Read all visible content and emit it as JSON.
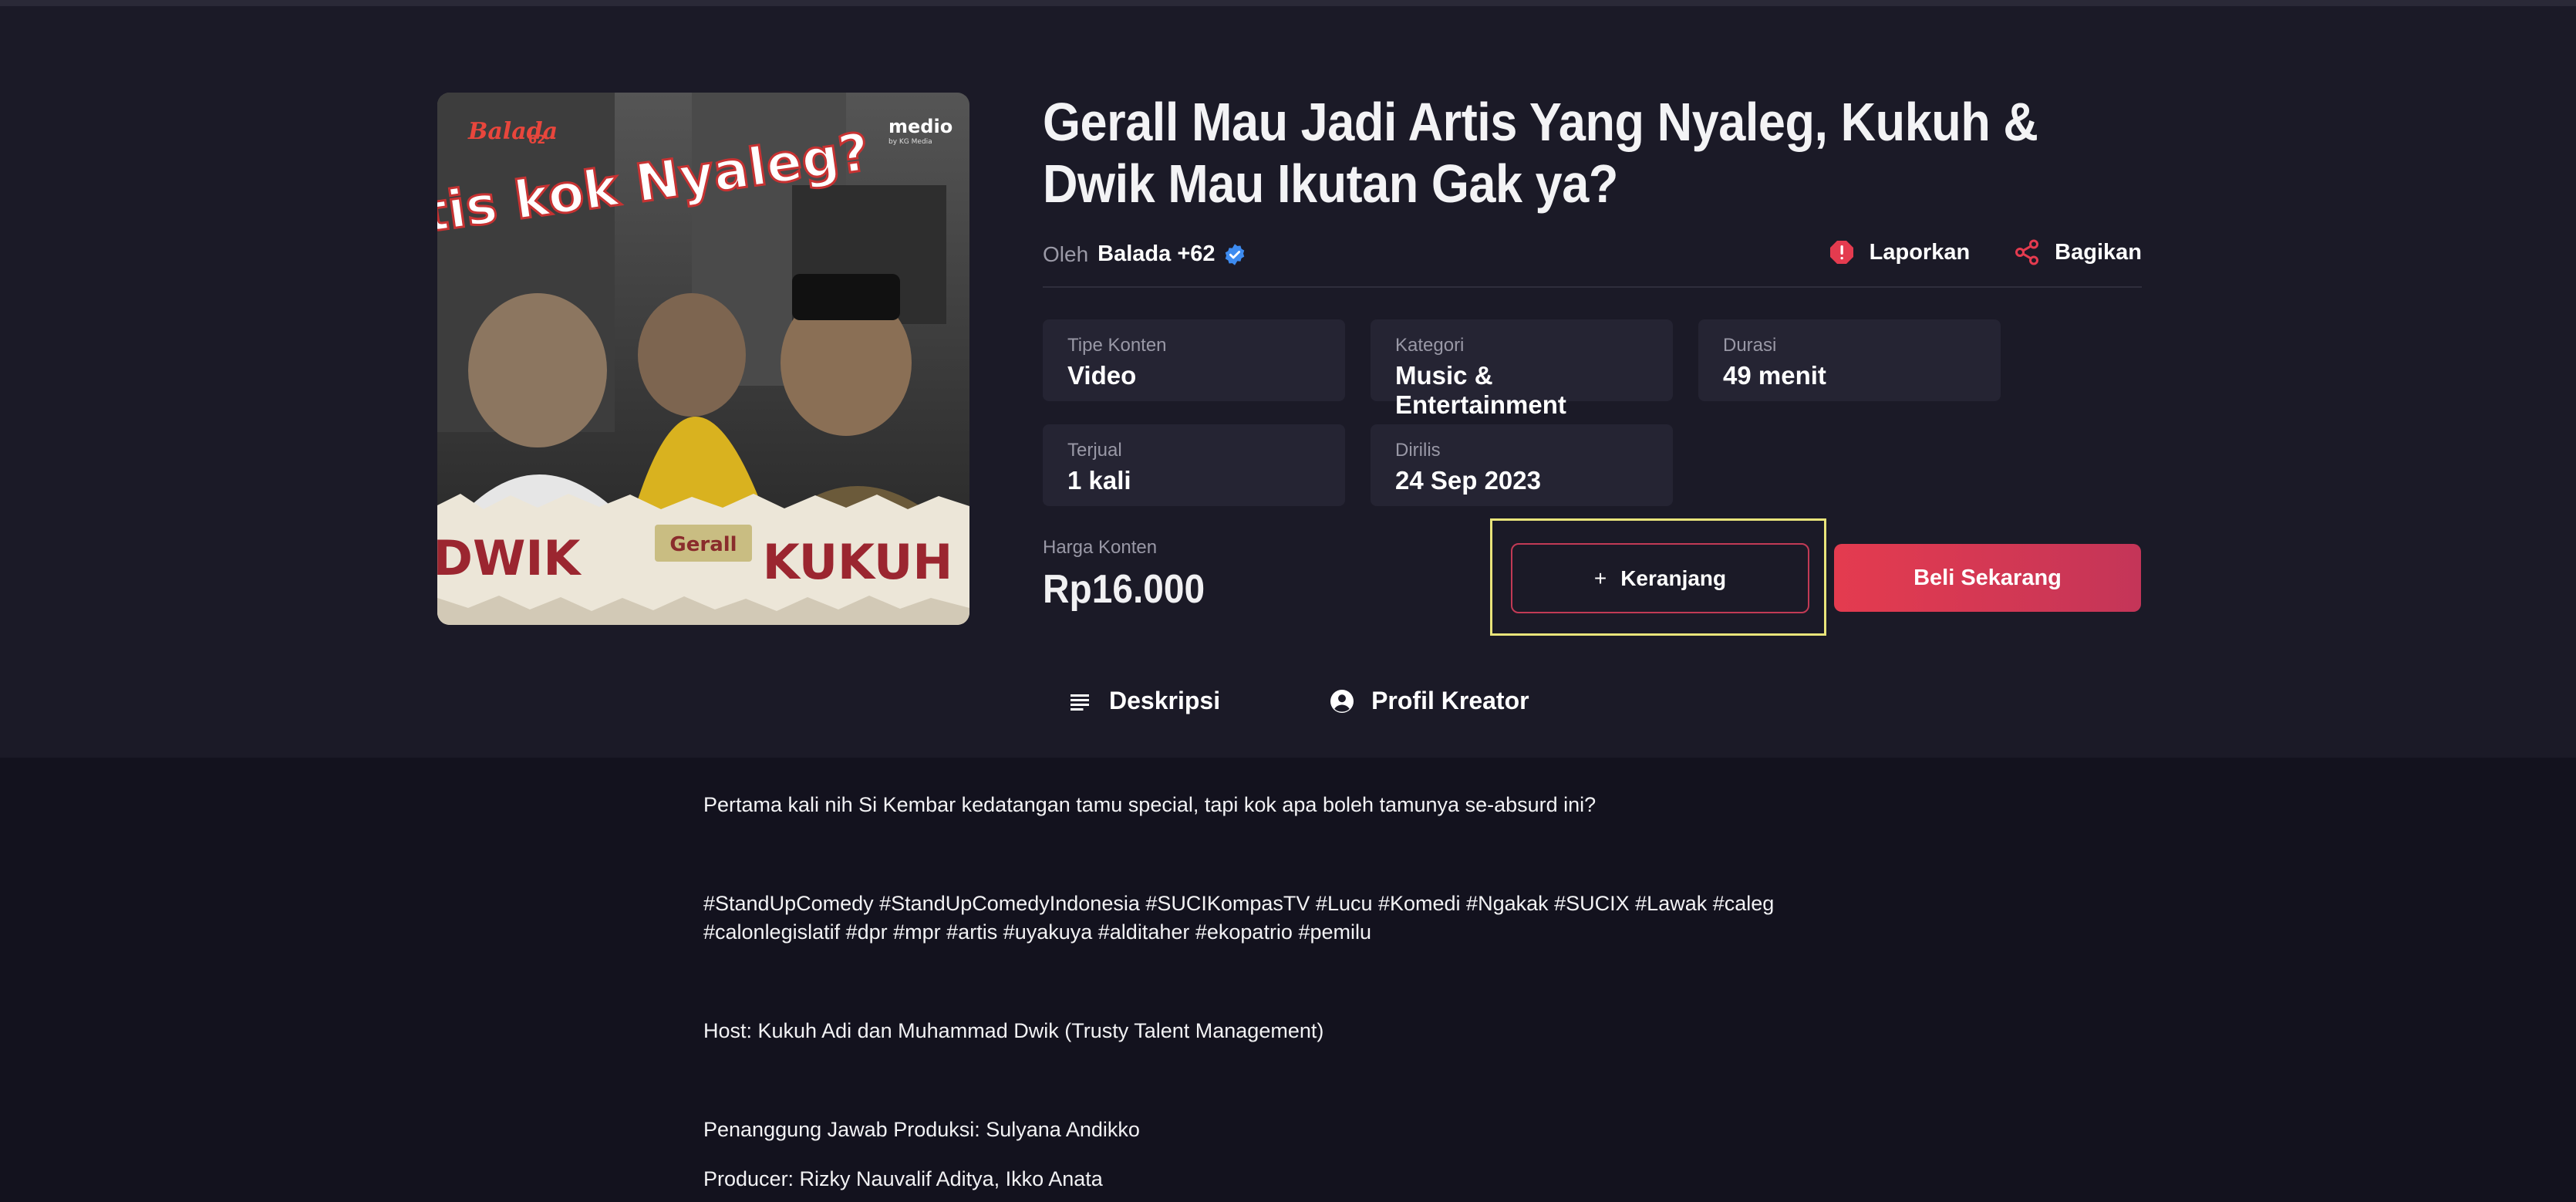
{
  "product": {
    "title": "Gerall Mau Jadi Artis Yang Nyaleg, Kukuh & Dwik Mau Ikutan Gak ya?",
    "by_label": "Oleh",
    "author": "Balada +62",
    "report_label": "Laporkan",
    "share_label": "Bagikan",
    "cover": {
      "brand": "Balada",
      "brand_sup": "62",
      "publisher": "medio",
      "publisher_sub": "by KG Media",
      "headline": "Artis kok Nyaleg?",
      "name_left": "DWIK",
      "name_center": "Gerall",
      "name_right": "KUKUH"
    }
  },
  "details": [
    {
      "label": "Tipe Konten",
      "value": "Video"
    },
    {
      "label": "Kategori",
      "value": "Music & Entertainment"
    },
    {
      "label": "Durasi",
      "value": "49 menit"
    },
    {
      "label": "Terjual",
      "value": "1 kali"
    },
    {
      "label": "Dirilis",
      "value": "24 Sep 2023"
    }
  ],
  "price": {
    "label": "Harga Konten",
    "value": "Rp16.000"
  },
  "buttons": {
    "cart_plus": "+",
    "cart": "Keranjang",
    "buy": "Beli Sekarang"
  },
  "tabs": [
    {
      "label": "Deskripsi",
      "icon": "list-icon"
    },
    {
      "label": "Profil Kreator",
      "icon": "account-circle-icon"
    }
  ],
  "description": [
    "Pertama kali nih Si Kembar kedatangan tamu special, tapi kok apa boleh tamunya se-absurd ini?",
    "#StandUpComedy #StandUpComedyIndonesia #SUCIKompasTV #Lucu #Komedi #Ngakak #SUCIX #Lawak #caleg",
    "#calonlegislatif #dpr #mpr #artis #uyakuya #alditaher #ekopatrio #pemilu",
    "Host: Kukuh Adi dan Muhammad Dwik (Trusty Talent Management)",
    "Penanggung Jawab Produksi: Sulyana Andikko",
    "Producer: Rizky Nauvalif Aditya, Ikko Anata"
  ],
  "colors": {
    "background": "#1b1a27",
    "card": "#252433",
    "accent": "#e43b4f",
    "highlight": "#e9e47a",
    "verified": "#3d8bf0"
  }
}
